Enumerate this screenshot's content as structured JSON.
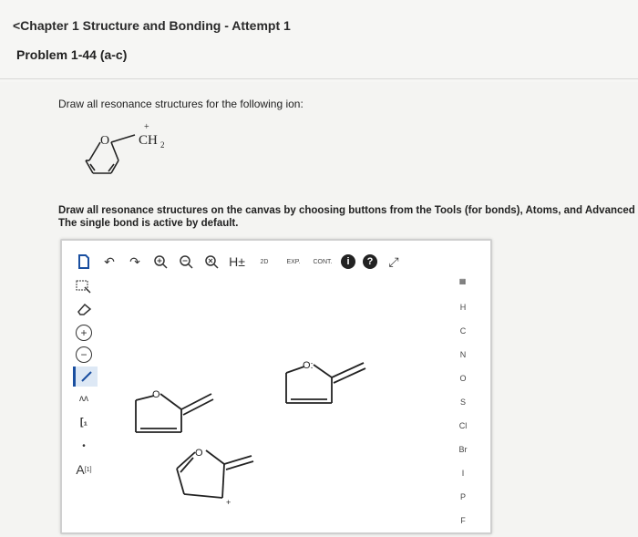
{
  "header": {
    "back_label": "<Chapter 1 Structure and Bonding - Attempt 1",
    "problem_title": "Problem 1-44 (a-c)"
  },
  "question": {
    "text": "Draw all resonance structures for the following ion:",
    "ion_label": "CH",
    "ion_subscript": "2",
    "ion_charge": "+",
    "ring_atom": "O"
  },
  "instructions": {
    "line1": "Draw all resonance structures on the canvas by choosing buttons from the Tools (for bonds), Atoms, and Advanced",
    "line2": "The single bond is active by default."
  },
  "toolbar": {
    "h_label": "H±",
    "label_2d": "2D",
    "exp_label": "EXP.",
    "cont_label": "CONT.",
    "info_label": "i",
    "help_label": "?"
  },
  "atoms": [
    "H",
    "C",
    "N",
    "O",
    "S",
    "Cl",
    "Br",
    "I",
    "P",
    "F"
  ],
  "left_tools": {
    "plus_label": "+",
    "minus_label": "−",
    "chain_label": "ʌʌ",
    "bracket_label": "[₁",
    "atom_label": "A",
    "atom_index": "[1]"
  },
  "canvas": {
    "oxygen_label": "O",
    "lone_pair_label": "O:"
  }
}
